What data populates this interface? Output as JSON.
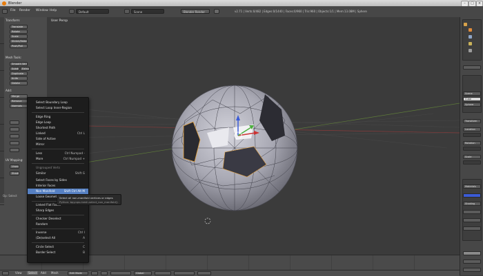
{
  "window": {
    "title": "Blender"
  },
  "info_bar": {
    "menus": [
      "File",
      "Render",
      "Window",
      "Help"
    ],
    "layout": "Default",
    "scene": "Scene",
    "engine": "Blender Render",
    "stats": "v2.71 | Verts:0/482 | Edges:0/1440 | Faces:0/960 | Tris:960 | Objects:1/1 | Mem:13.08M | Sphere"
  },
  "toolshelf": {
    "section_transform": "Transform:",
    "transform_buttons": [
      "Translate",
      "Rotate",
      "Scale",
      "Shrink/Fatten",
      "Push/Pull"
    ],
    "section_mesh_tools": "Mesh Tools:",
    "mesh_buttons": [
      "Smooth Vertex",
      "Subdivide",
      "Extrude",
      "Duplicate",
      "Knife",
      "Delete"
    ],
    "section_add": "Add:",
    "add_buttons": [
      "Merge",
      "Remove",
      "Normals"
    ],
    "section_uv": "UV Mapping:",
    "uv_buttons": [
      "Unwrap",
      "Shading"
    ],
    "last_op": "Op: Select"
  },
  "viewport": {
    "label": "User Persp"
  },
  "context_menu": {
    "items": [
      {
        "label": "Select Boundary Loop",
        "shortcut": ""
      },
      {
        "label": "Select Loop Inner-Region",
        "shortcut": ""
      },
      {
        "label": "Edge Ring",
        "shortcut": ""
      },
      {
        "label": "Edge Loop",
        "shortcut": ""
      },
      {
        "label": "Shortest Path",
        "shortcut": ""
      },
      {
        "label": "Linked",
        "shortcut": "Ctrl L"
      },
      {
        "label": "Side of Active",
        "shortcut": ""
      },
      {
        "label": "Mirror",
        "shortcut": ""
      },
      {
        "label": "Less",
        "shortcut": "Ctrl Numpad -"
      },
      {
        "label": "More",
        "shortcut": "Ctrl Numpad +"
      },
      {
        "label": "Ungrouped Verts",
        "shortcut": ""
      },
      {
        "label": "Similar",
        "shortcut": "Shift G"
      },
      {
        "label": "Select Faces by Sides",
        "shortcut": ""
      },
      {
        "label": "Interior Faces",
        "shortcut": ""
      },
      {
        "label": "Non Manifold",
        "shortcut": "Shift Ctrl Alt M"
      },
      {
        "label": "Loose Geometry",
        "shortcut": ""
      },
      {
        "label": "Linked Flat Faces",
        "shortcut": ""
      },
      {
        "label": "Sharp Edges",
        "shortcut": ""
      },
      {
        "label": "Checker Deselect",
        "shortcut": ""
      },
      {
        "label": "Random",
        "shortcut": ""
      },
      {
        "label": "Inverse",
        "shortcut": "Ctrl I"
      },
      {
        "label": "(De)select All",
        "shortcut": "A"
      },
      {
        "label": "Circle Select",
        "shortcut": "C"
      },
      {
        "label": "Border Select",
        "shortcut": "B"
      }
    ]
  },
  "tooltip": {
    "text": "Select all non-manifold vertices or edges",
    "python": "Python: bpy.ops.mesh.select_non_manifold()"
  },
  "header": {
    "menus": [
      "View",
      "Select",
      "Add",
      "Mesh"
    ],
    "mode": "Edit Mode",
    "pivot": "Global"
  },
  "properties": {
    "labels": [
      "Scene",
      "Cube",
      "Sphere",
      "Transform",
      "Location",
      "Rotation",
      "Scale",
      "Materials",
      "Shading"
    ]
  },
  "colors": {
    "accent_highlight": "#5680c2",
    "selection_orange": "#e8a33d",
    "blender_orange": "#e87d0d"
  }
}
